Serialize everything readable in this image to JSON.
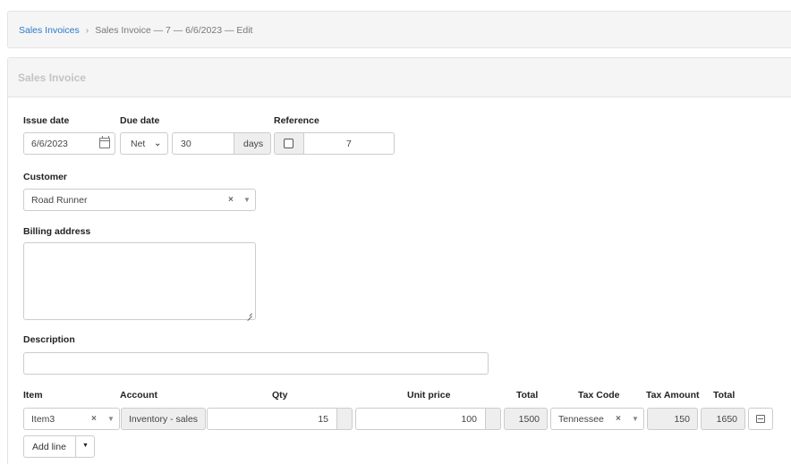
{
  "breadcrumb": {
    "root": "Sales Invoices",
    "separator": "›",
    "current": "Sales Invoice — 7 — 6/6/2023 — Edit"
  },
  "panel": {
    "title": "Sales Invoice"
  },
  "form": {
    "issue_date_label": "Issue date",
    "issue_date_value": "6/6/2023",
    "due_date_label": "Due date",
    "due_date_type": "Net",
    "due_date_days": "30",
    "due_date_unit": "days",
    "reference_label": "Reference",
    "reference_value": "7",
    "customer_label": "Customer",
    "customer_value": "Road Runner",
    "billing_address_label": "Billing address",
    "billing_address_value": "",
    "description_label": "Description",
    "description_value": ""
  },
  "lines": {
    "headers": {
      "item": "Item",
      "account": "Account",
      "qty": "Qty",
      "unit_price": "Unit price",
      "total": "Total",
      "tax_code": "Tax Code",
      "tax_amount": "Tax Amount",
      "grand_total": "Total"
    },
    "rows": [
      {
        "item": "Item3",
        "account": "Inventory - sales",
        "qty": "15",
        "unit_price": "100",
        "total": "1500",
        "tax_code": "Tennessee",
        "tax_amount": "150",
        "grand_total": "1650"
      }
    ],
    "add_line_label": "Add line"
  },
  "icons": {
    "clear": "×",
    "dropdown": "▼",
    "select_caret": "⌄"
  }
}
